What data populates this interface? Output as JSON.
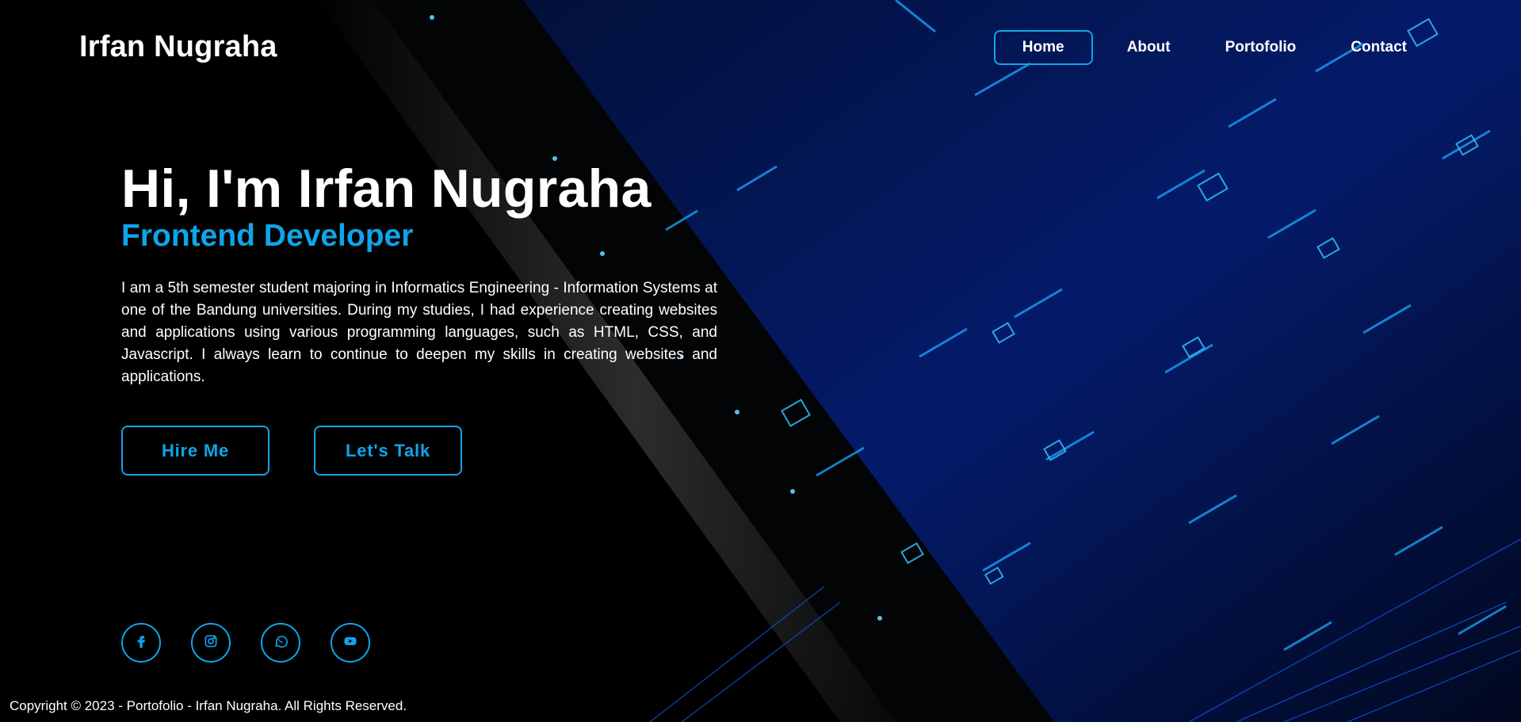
{
  "brand": {
    "name": "Irfan Nugraha"
  },
  "nav": {
    "items": [
      {
        "label": "Home",
        "active": true
      },
      {
        "label": "About",
        "active": false
      },
      {
        "label": "Portofolio",
        "active": false
      },
      {
        "label": "Contact",
        "active": false
      }
    ]
  },
  "hero": {
    "title": "Hi, I'm Irfan Nugraha",
    "subtitle": "Frontend Developer",
    "description": "I am a 5th semester student majoring in Informatics Engineering - Information Systems at one of the Bandung universities. During my studies, I had experience creating websites and applications using various programming languages, such as HTML, CSS, and Javascript. I always learn to continue to deepen my skills in creating websites and applications."
  },
  "buttons": {
    "hire": "Hire Me",
    "talk": "Let's Talk"
  },
  "socials": [
    {
      "icon": "facebook-icon"
    },
    {
      "icon": "instagram-icon"
    },
    {
      "icon": "whatsapp-icon"
    },
    {
      "icon": "youtube-icon"
    }
  ],
  "footer": {
    "copyright": "Copyright © 2023 - Portofolio - Irfan Nugraha. All Rights Reserved."
  },
  "colors": {
    "accent": "#0ea5e9",
    "background": "#000000"
  }
}
